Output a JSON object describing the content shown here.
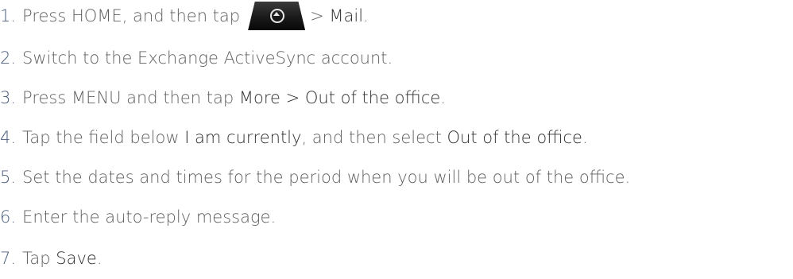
{
  "steps": [
    {
      "num": "1.",
      "parts": [
        "Press HOME, and then tap",
        "> ",
        "Mail",
        "."
      ]
    },
    {
      "num": "2.",
      "text": "Switch to the Exchange ActiveSync account."
    },
    {
      "num": "3.",
      "parts": [
        "Press MENU and then tap ",
        "More > Out of the office",
        "."
      ]
    },
    {
      "num": "4.",
      "parts": [
        "Tap the field below ",
        "I am currently",
        ", and then select ",
        "Out of the office",
        "."
      ]
    },
    {
      "num": "5.",
      "text": "Set the dates and times for the period when you will be out of the office."
    },
    {
      "num": "6.",
      "text": "Enter the auto-reply message."
    },
    {
      "num": "7.",
      "parts": [
        "Tap ",
        "Save",
        "."
      ]
    }
  ],
  "icons": {
    "all_apps": "all-apps-icon"
  }
}
